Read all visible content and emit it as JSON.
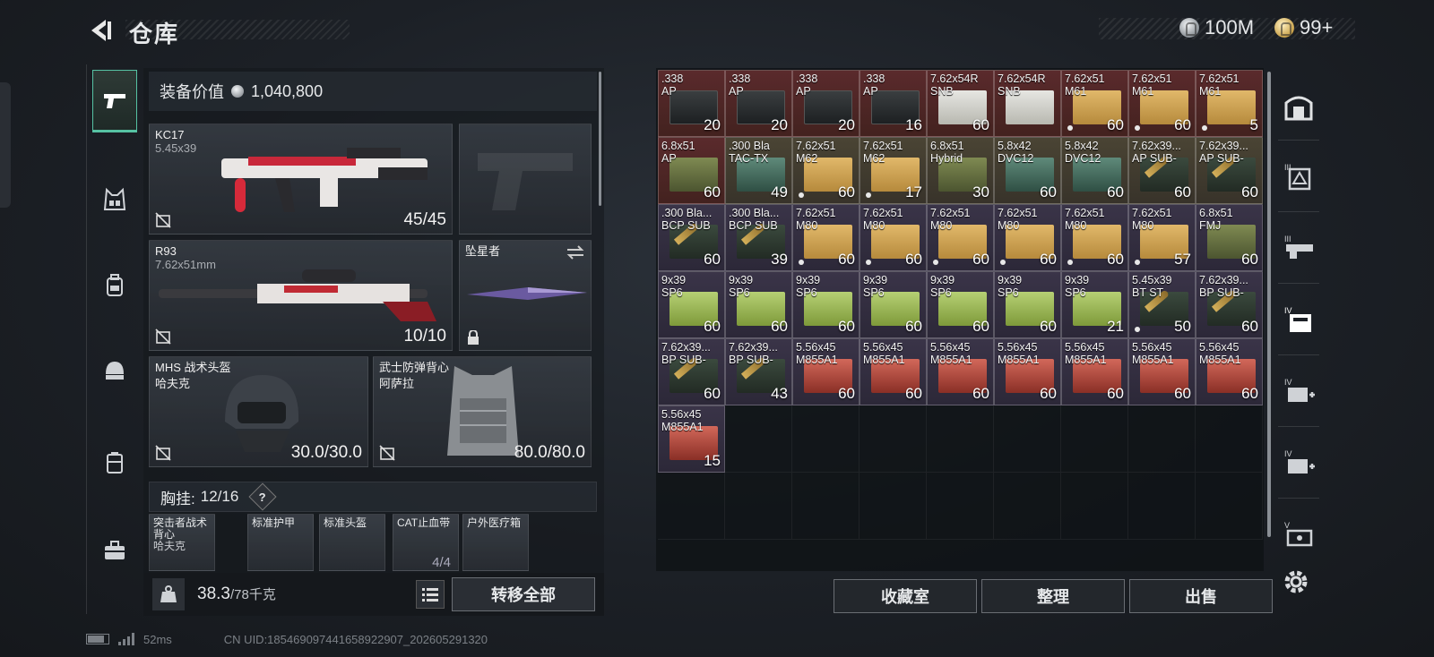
{
  "header": {
    "title": "仓库"
  },
  "currency": {
    "silver": "100M",
    "gold": "99+"
  },
  "equipment": {
    "value_label": "装备价值",
    "value": "1,040,800",
    "primary": {
      "name": "KC17",
      "caliber": "5.45x39",
      "durability": "45/45"
    },
    "secondary": {
      "name": "R93",
      "caliber": "7.62x51mm",
      "durability": "10/10"
    },
    "melee": {
      "name": "坠星者"
    },
    "helmet": {
      "name": "MHS 战术头盔",
      "sub": "哈夫克",
      "durability": "30.0/30.0"
    },
    "armor": {
      "name": "武士防弹背心",
      "sub": "阿萨拉",
      "durability": "80.0/80.0"
    },
    "chest": {
      "label": "胸挂:",
      "count": "12/16",
      "help": "?"
    },
    "slots": [
      {
        "name": "突击者战术背心",
        "sub": "哈夫克",
        "count": ""
      },
      {
        "name": "标准护甲",
        "sub": "",
        "count": ""
      },
      {
        "name": "标准头盔",
        "sub": "",
        "count": ""
      },
      {
        "name": "CAT止血带",
        "sub": "",
        "count": "4/4"
      },
      {
        "name": "户外医疗箱",
        "sub": "",
        "count": ""
      }
    ],
    "weight": {
      "current": "38.3",
      "max": "/78千克"
    },
    "transfer_all": "转移全部"
  },
  "storage": {
    "items": [
      {
        "label": ".338\nAP",
        "count": "20",
        "bg": "red",
        "box": "dark",
        "dot": false
      },
      {
        "label": ".338\nAP",
        "count": "20",
        "bg": "red",
        "box": "dark",
        "dot": false
      },
      {
        "label": ".338\nAP",
        "count": "20",
        "bg": "red",
        "box": "dark",
        "dot": false
      },
      {
        "label": ".338\nAP",
        "count": "16",
        "bg": "red",
        "box": "dark",
        "dot": false
      },
      {
        "label": "7.62x54R\nSNB",
        "count": "60",
        "bg": "red",
        "box": "white",
        "dot": false
      },
      {
        "label": "7.62x54R\nSNB",
        "count": "",
        "bg": "red",
        "box": "white",
        "dot": false
      },
      {
        "label": "7.62x51\nM61",
        "count": "60",
        "bg": "red",
        "box": "tan",
        "dot": true
      },
      {
        "label": "7.62x51\nM61",
        "count": "60",
        "bg": "red",
        "box": "tan",
        "dot": true
      },
      {
        "label": "7.62x51\nM61",
        "count": "5",
        "bg": "red",
        "box": "tan",
        "dot": true
      },
      {
        "label": "6.8x51\nAP",
        "count": "60",
        "bg": "red",
        "box": "olive",
        "dot": false
      },
      {
        "label": ".300 Bla\nTAC-TX",
        "count": "49",
        "bg": "gold",
        "box": "teal",
        "dot": false
      },
      {
        "label": "7.62x51\nM62",
        "count": "60",
        "bg": "gold",
        "box": "tan",
        "dot": true
      },
      {
        "label": "7.62x51\nM62",
        "count": "17",
        "bg": "gold",
        "box": "tan",
        "dot": true
      },
      {
        "label": "6.8x51\nHybrid",
        "count": "30",
        "bg": "gold",
        "box": "olive",
        "dot": false
      },
      {
        "label": "5.8x42\nDVC12",
        "count": "60",
        "bg": "gold",
        "box": "teal",
        "dot": false
      },
      {
        "label": "5.8x42\nDVC12",
        "count": "60",
        "bg": "gold",
        "box": "teal",
        "dot": false
      },
      {
        "label": "7.62x39...\nAP SUB-",
        "count": "60",
        "bg": "gold",
        "box": "bullets",
        "dot": false
      },
      {
        "label": "7.62x39...\nAP SUB-",
        "count": "60",
        "bg": "gold",
        "box": "bullets",
        "dot": false
      },
      {
        "label": ".300 Bla...\nBCP SUB",
        "count": "60",
        "bg": "purple",
        "box": "bullets",
        "dot": false
      },
      {
        "label": ".300 Bla...\nBCP SUB",
        "count": "39",
        "bg": "purple",
        "box": "bullets",
        "dot": false
      },
      {
        "label": "7.62x51\nM80",
        "count": "60",
        "bg": "purple",
        "box": "tan",
        "dot": true
      },
      {
        "label": "7.62x51\nM80",
        "count": "60",
        "bg": "purple",
        "box": "tan",
        "dot": true
      },
      {
        "label": "7.62x51\nM80",
        "count": "60",
        "bg": "purple",
        "box": "tan",
        "dot": true
      },
      {
        "label": "7.62x51\nM80",
        "count": "60",
        "bg": "purple",
        "box": "tan",
        "dot": true
      },
      {
        "label": "7.62x51\nM80",
        "count": "60",
        "bg": "purple",
        "box": "tan",
        "dot": true
      },
      {
        "label": "7.62x51\nM80",
        "count": "57",
        "bg": "purple",
        "box": "tan",
        "dot": true
      },
      {
        "label": "6.8x51\nFMJ",
        "count": "60",
        "bg": "purple",
        "box": "olive",
        "dot": false
      },
      {
        "label": "9x39\nSP6",
        "count": "60",
        "bg": "purple",
        "box": "green",
        "dot": false
      },
      {
        "label": "9x39\nSP6",
        "count": "60",
        "bg": "purple",
        "box": "green",
        "dot": false
      },
      {
        "label": "9x39\nSP6",
        "count": "60",
        "bg": "purple",
        "box": "green",
        "dot": false
      },
      {
        "label": "9x39\nSP6",
        "count": "60",
        "bg": "purple",
        "box": "green",
        "dot": false
      },
      {
        "label": "9x39\nSP6",
        "count": "60",
        "bg": "purple",
        "box": "green",
        "dot": false
      },
      {
        "label": "9x39\nSP6",
        "count": "60",
        "bg": "purple",
        "box": "green",
        "dot": false
      },
      {
        "label": "9x39\nSP6",
        "count": "21",
        "bg": "purple",
        "box": "green",
        "dot": false
      },
      {
        "label": "5.45x39\nBT ST",
        "count": "50",
        "bg": "purple",
        "box": "bullets",
        "dot": true
      },
      {
        "label": "7.62x39...\nBP SUB-",
        "count": "60",
        "bg": "purple",
        "box": "bullets",
        "dot": false
      },
      {
        "label": "7.62x39...\nBP SUB-",
        "count": "60",
        "bg": "purple",
        "box": "bullets",
        "dot": false
      },
      {
        "label": "7.62x39...\nBP SUB-",
        "count": "43",
        "bg": "purple",
        "box": "bullets",
        "dot": false
      },
      {
        "label": "5.56x45\nM855A1",
        "count": "60",
        "bg": "purple",
        "box": "redbox",
        "dot": false
      },
      {
        "label": "5.56x45\nM855A1",
        "count": "60",
        "bg": "purple",
        "box": "redbox",
        "dot": false
      },
      {
        "label": "5.56x45\nM855A1",
        "count": "60",
        "bg": "purple",
        "box": "redbox",
        "dot": false
      },
      {
        "label": "5.56x45\nM855A1",
        "count": "60",
        "bg": "purple",
        "box": "redbox",
        "dot": false
      },
      {
        "label": "5.56x45\nM855A1",
        "count": "60",
        "bg": "purple",
        "box": "redbox",
        "dot": false
      },
      {
        "label": "5.56x45\nM855A1",
        "count": "60",
        "bg": "purple",
        "box": "redbox",
        "dot": false
      },
      {
        "label": "5.56x45\nM855A1",
        "count": "60",
        "bg": "purple",
        "box": "redbox",
        "dot": false
      },
      {
        "label": "5.56x45\nM855A1",
        "count": "15",
        "bg": "purple",
        "box": "redbox",
        "dot": false
      }
    ],
    "buttons": {
      "collection": "收藏室",
      "sort": "整理",
      "sell": "出售"
    }
  },
  "right_rail": {
    "tabs": [
      {
        "icon": "building-icon",
        "label": ""
      },
      {
        "icon": "tier-3-container-icon",
        "label": "III"
      },
      {
        "icon": "tier-3-weapon-case-icon",
        "label": "III"
      },
      {
        "icon": "tier-4-folder-icon",
        "label": "IV"
      },
      {
        "icon": "tier-4-medkit-icon",
        "label": "IV"
      },
      {
        "icon": "tier-4-medkit-icon",
        "label": "IV"
      },
      {
        "icon": "tier-5-case-icon",
        "label": "V"
      }
    ]
  },
  "status": {
    "ping": "52ms",
    "uid": "CN UID:1854690974416589229​07_202605291320"
  },
  "colors": {
    "accent": "#56c2a3",
    "slot_red": "#5a2a2c",
    "slot_gold": "#4a4434",
    "slot_purple": "#3a3448"
  }
}
